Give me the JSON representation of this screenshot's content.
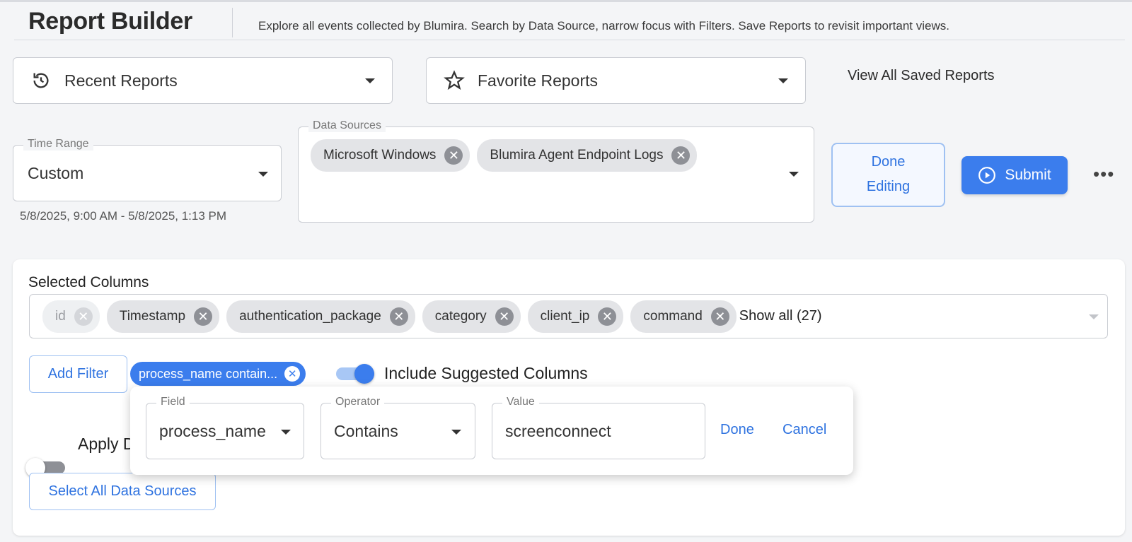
{
  "header": {
    "title": "Report Builder",
    "subtitle": "Explore all events collected by Blumira. Search by Data Source, narrow focus with Filters. Save Reports to revisit important views."
  },
  "reports": {
    "recent_label": "Recent Reports",
    "favorite_label": "Favorite Reports",
    "view_all_label": "View All Saved Reports"
  },
  "time_range": {
    "legend": "Time Range",
    "value": "Custom",
    "range_text": "5/8/2025, 9:00 AM - 5/8/2025, 1:13 PM"
  },
  "data_sources": {
    "legend": "Data Sources",
    "chips": [
      "Microsoft Windows",
      "Blumira Agent Endpoint Logs"
    ]
  },
  "actions": {
    "done_editing_line1": "Done",
    "done_editing_line2": "Editing",
    "submit_label": "Submit",
    "more_label": "•••"
  },
  "columns": {
    "title": "Selected Columns",
    "chips": [
      "id",
      "Timestamp",
      "authentication_package",
      "category",
      "client_ip",
      "command"
    ],
    "show_all": "Show all (27)"
  },
  "filters": {
    "add_filter_label": "Add Filter",
    "active_chip": "process_name contain...",
    "suggested_label": "Include Suggested Columns",
    "apply_label": "Apply D",
    "select_all_label": "Select All Data Sources"
  },
  "filter_editor": {
    "field_legend": "Field",
    "field_value": "process_name",
    "operator_legend": "Operator",
    "operator_value": "Contains",
    "value_legend": "Value",
    "value_value": "screenconnect",
    "done_label": "Done",
    "cancel_label": "Cancel"
  },
  "colors": {
    "primary": "#3b7ded",
    "link": "#2f73e0",
    "background": "#f4f5f7"
  }
}
